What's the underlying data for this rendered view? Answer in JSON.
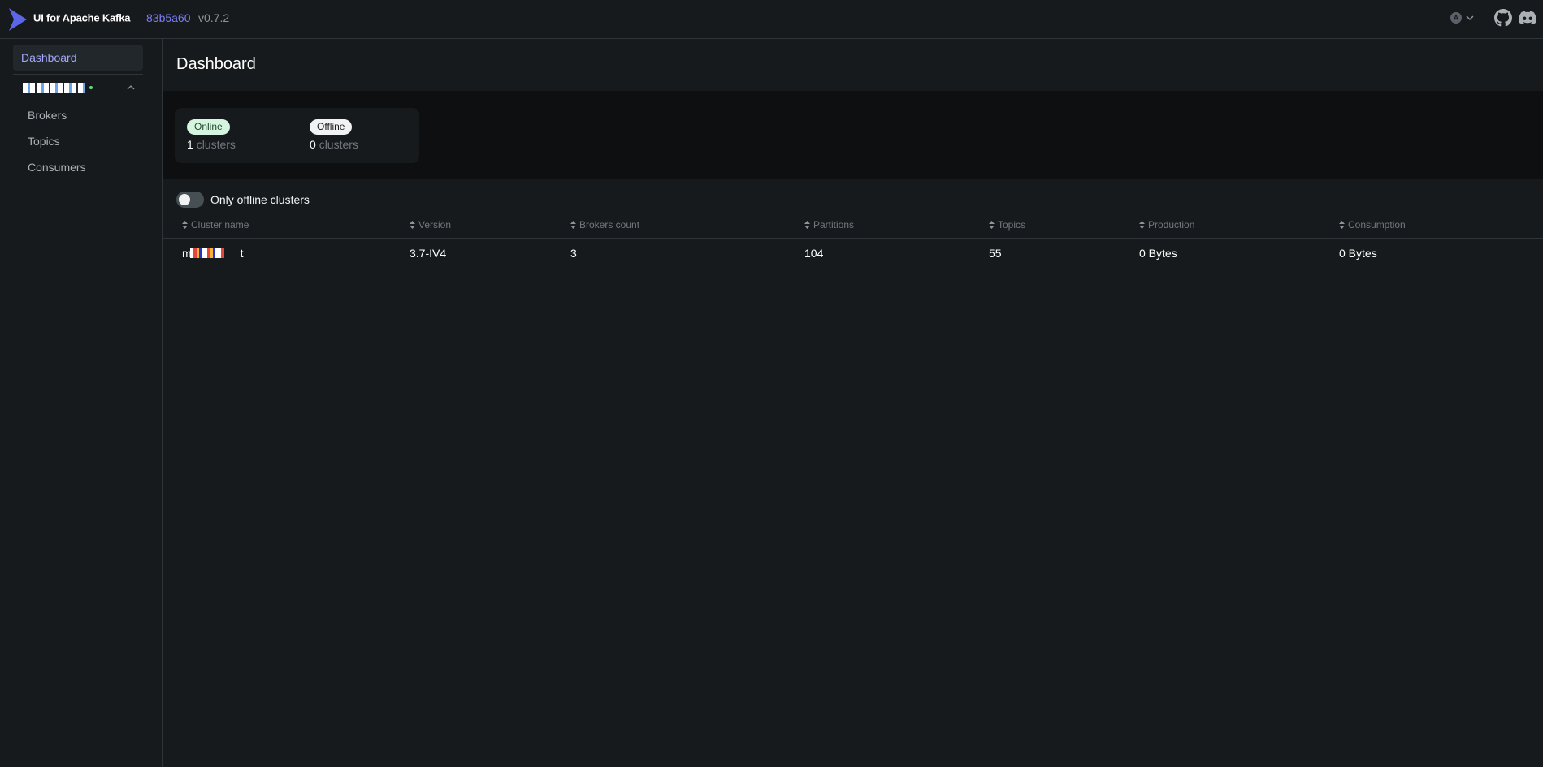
{
  "topnav": {
    "brand_name": "UI for Apache Kafka",
    "version_commit": "83b5a60",
    "version_tag": "v0.7.2",
    "theme_toggle_letter": "A",
    "icons": [
      "kafka-logo-icon",
      "theme-auto-icon",
      "chevron-down-icon",
      "github-icon",
      "discord-icon"
    ]
  },
  "sidebar": {
    "dashboard_label": "Dashboard",
    "cluster": {
      "status_color": "#5BE176"
    },
    "items": [
      {
        "label": "Brokers"
      },
      {
        "label": "Topics"
      },
      {
        "label": "Consumers"
      }
    ]
  },
  "main": {
    "title": "Dashboard",
    "metrics": {
      "online": {
        "badge": "Online",
        "count": "1",
        "unit": "clusters"
      },
      "offline": {
        "badge": "Offline",
        "count": "0",
        "unit": "clusters"
      }
    },
    "filter_label": "Only offline clusters",
    "table": {
      "columns": [
        "Cluster name",
        "Version",
        "Brokers count",
        "Partitions",
        "Topics",
        "Production",
        "Consumption"
      ],
      "rows": [
        {
          "cluster_name_visible_start": "m",
          "cluster_name_visible_end": "t",
          "version": "3.7-IV4",
          "brokers": "3",
          "partitions": "104",
          "topics": "55",
          "production": "0 Bytes",
          "consumption": "0 Bytes"
        }
      ]
    }
  },
  "colors": {
    "background": "#171A1C",
    "accent": "#7A7DF7",
    "border": "#2F3439",
    "online_badge": "#D6F5E0"
  }
}
